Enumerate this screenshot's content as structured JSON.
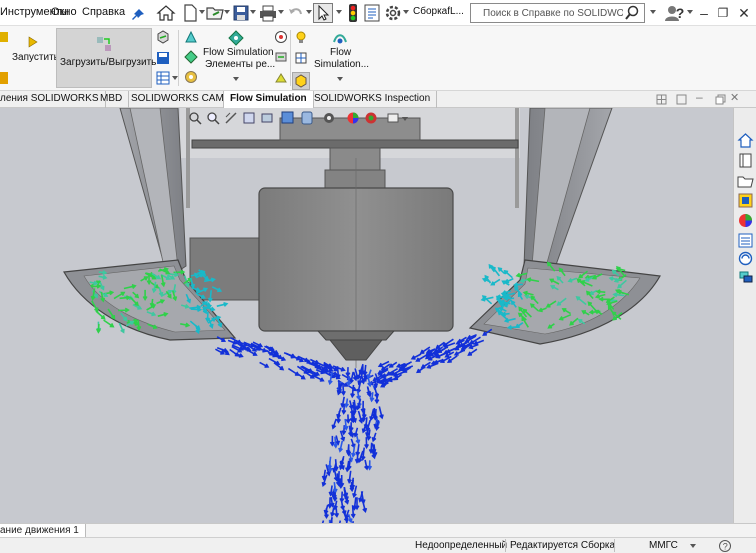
{
  "menu": {
    "items": [
      "Инструменты",
      "Окно",
      "Справка"
    ]
  },
  "titlebar": {
    "doc_title": "СборкаfL...",
    "search_placeholder": "Поиск в Справке по SOLIDWORKS"
  },
  "ribbon": {
    "run_label": "Запустить",
    "upload_label": "Загрузить/Выгрузить",
    "flow_features_line1": "Flow Simulation",
    "flow_features_line2": "Элементы ре...",
    "flow_sim_line1": "Flow",
    "flow_sim_line2": "Simulation..."
  },
  "tabs": [
    {
      "label": "ления SOLIDWORKS",
      "active": false
    },
    {
      "label": "MBD",
      "active": false
    },
    {
      "label": "SOLIDWORKS CAM",
      "active": false
    },
    {
      "label": "Flow Simulation",
      "active": true
    },
    {
      "label": "SOLIDWORKS Inspection",
      "active": false
    }
  ],
  "motion_tab": "ание движения 1",
  "status": {
    "definition": "Недоопределенный",
    "mode": "Редактируется Сборка",
    "units": "ММГС"
  },
  "colors": {
    "accent_blue": "#1f5fbf",
    "viewport_bg": "#c8cad0",
    "part_gray": "#8c8c8c",
    "vector_green": "#2fd14a",
    "vector_blue": "#1230d8"
  },
  "icons": {
    "home": "home-icon",
    "new": "new-document-icon",
    "open": "open-folder-icon",
    "save": "save-icon",
    "print": "print-icon",
    "undo": "undo-icon",
    "select": "select-cursor-icon",
    "rebuild": "traffic-light-icon",
    "options": "gear-icon",
    "search": "magnifier-icon",
    "user": "user-icon",
    "help": "help-icon"
  }
}
